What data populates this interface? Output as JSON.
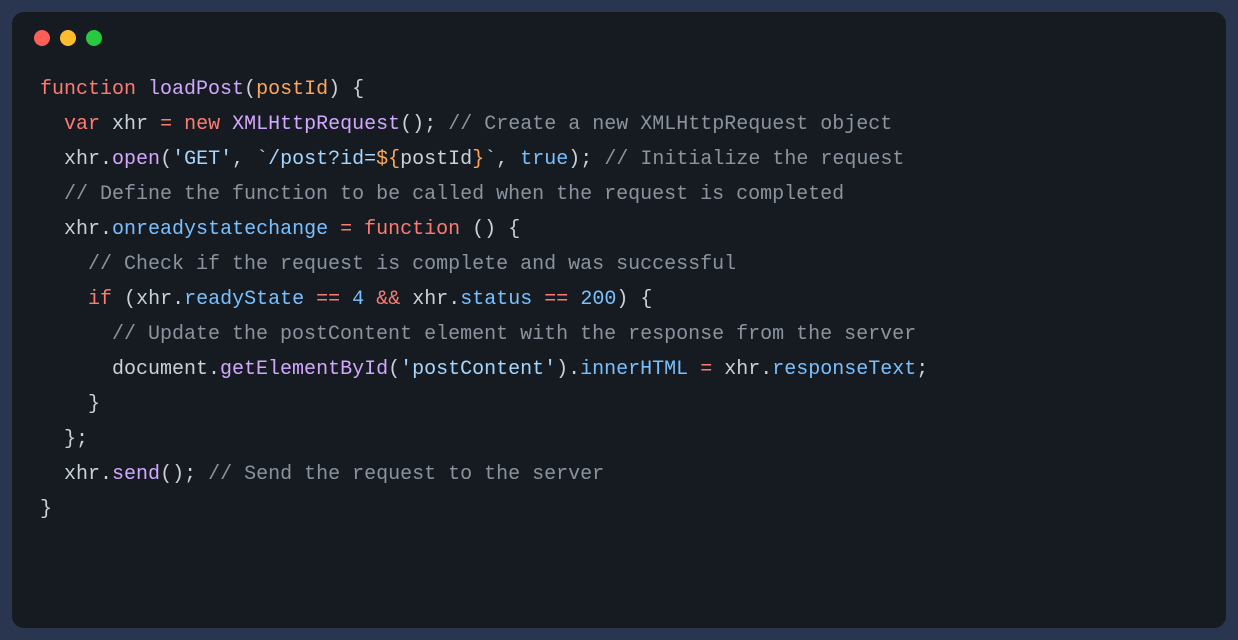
{
  "window": {
    "controls": [
      "close",
      "minimize",
      "maximize"
    ]
  },
  "code": {
    "language": "javascript",
    "tokens": [
      [
        {
          "t": "keyword",
          "v": "function"
        },
        {
          "t": "space",
          "v": " "
        },
        {
          "t": "func",
          "v": "loadPost"
        },
        {
          "t": "punct",
          "v": "("
        },
        {
          "t": "param",
          "v": "postId"
        },
        {
          "t": "punct",
          "v": ")"
        },
        {
          "t": "space",
          "v": " "
        },
        {
          "t": "punct",
          "v": "{"
        }
      ],
      [
        {
          "t": "indent",
          "v": "  "
        },
        {
          "t": "keyword",
          "v": "var"
        },
        {
          "t": "space",
          "v": " "
        },
        {
          "t": "ident",
          "v": "xhr"
        },
        {
          "t": "space",
          "v": " "
        },
        {
          "t": "op",
          "v": "="
        },
        {
          "t": "space",
          "v": " "
        },
        {
          "t": "keyword",
          "v": "new"
        },
        {
          "t": "space",
          "v": " "
        },
        {
          "t": "func",
          "v": "XMLHttpRequest"
        },
        {
          "t": "punct",
          "v": "()"
        },
        {
          "t": "punct",
          "v": ";"
        },
        {
          "t": "space",
          "v": " "
        },
        {
          "t": "comment",
          "v": "// Create a new XMLHttpRequest object"
        }
      ],
      [
        {
          "t": "indent",
          "v": "  "
        },
        {
          "t": "ident",
          "v": "xhr"
        },
        {
          "t": "punct",
          "v": "."
        },
        {
          "t": "func",
          "v": "open"
        },
        {
          "t": "punct",
          "v": "("
        },
        {
          "t": "string",
          "v": "'GET'"
        },
        {
          "t": "punct",
          "v": ","
        },
        {
          "t": "space",
          "v": " "
        },
        {
          "t": "string",
          "v": "`/post?id="
        },
        {
          "t": "interp",
          "v": "${"
        },
        {
          "t": "ident",
          "v": "postId"
        },
        {
          "t": "interp",
          "v": "}"
        },
        {
          "t": "string",
          "v": "`"
        },
        {
          "t": "punct",
          "v": ","
        },
        {
          "t": "space",
          "v": " "
        },
        {
          "t": "bool",
          "v": "true"
        },
        {
          "t": "punct",
          "v": ")"
        },
        {
          "t": "punct",
          "v": ";"
        },
        {
          "t": "space",
          "v": " "
        },
        {
          "t": "comment",
          "v": "// Initialize the request"
        }
      ],
      [
        {
          "t": "indent",
          "v": "  "
        },
        {
          "t": "comment",
          "v": "// Define the function to be called when the request is completed"
        }
      ],
      [
        {
          "t": "indent",
          "v": "  "
        },
        {
          "t": "ident",
          "v": "xhr"
        },
        {
          "t": "punct",
          "v": "."
        },
        {
          "t": "prop",
          "v": "onreadystatechange"
        },
        {
          "t": "space",
          "v": " "
        },
        {
          "t": "op",
          "v": "="
        },
        {
          "t": "space",
          "v": " "
        },
        {
          "t": "keyword",
          "v": "function"
        },
        {
          "t": "space",
          "v": " "
        },
        {
          "t": "punct",
          "v": "()"
        },
        {
          "t": "space",
          "v": " "
        },
        {
          "t": "punct",
          "v": "{"
        }
      ],
      [
        {
          "t": "indent",
          "v": "    "
        },
        {
          "t": "comment",
          "v": "// Check if the request is complete and was successful"
        }
      ],
      [
        {
          "t": "indent",
          "v": "    "
        },
        {
          "t": "keyword",
          "v": "if"
        },
        {
          "t": "space",
          "v": " "
        },
        {
          "t": "punct",
          "v": "("
        },
        {
          "t": "ident",
          "v": "xhr"
        },
        {
          "t": "punct",
          "v": "."
        },
        {
          "t": "prop",
          "v": "readyState"
        },
        {
          "t": "space",
          "v": " "
        },
        {
          "t": "op",
          "v": "=="
        },
        {
          "t": "space",
          "v": " "
        },
        {
          "t": "num",
          "v": "4"
        },
        {
          "t": "space",
          "v": " "
        },
        {
          "t": "op",
          "v": "&&"
        },
        {
          "t": "space",
          "v": " "
        },
        {
          "t": "ident",
          "v": "xhr"
        },
        {
          "t": "punct",
          "v": "."
        },
        {
          "t": "prop",
          "v": "status"
        },
        {
          "t": "space",
          "v": " "
        },
        {
          "t": "op",
          "v": "=="
        },
        {
          "t": "space",
          "v": " "
        },
        {
          "t": "num",
          "v": "200"
        },
        {
          "t": "punct",
          "v": ")"
        },
        {
          "t": "space",
          "v": " "
        },
        {
          "t": "punct",
          "v": "{"
        }
      ],
      [
        {
          "t": "indent",
          "v": "      "
        },
        {
          "t": "comment",
          "v": "// Update the postContent element with the response from the server"
        }
      ],
      [
        {
          "t": "indent",
          "v": "      "
        },
        {
          "t": "ident",
          "v": "document"
        },
        {
          "t": "punct",
          "v": "."
        },
        {
          "t": "func",
          "v": "getElementById"
        },
        {
          "t": "punct",
          "v": "("
        },
        {
          "t": "string",
          "v": "'postContent'"
        },
        {
          "t": "punct",
          "v": ")"
        },
        {
          "t": "punct",
          "v": "."
        },
        {
          "t": "prop",
          "v": "innerHTML"
        },
        {
          "t": "space",
          "v": " "
        },
        {
          "t": "op",
          "v": "="
        },
        {
          "t": "space",
          "v": " "
        },
        {
          "t": "ident",
          "v": "xhr"
        },
        {
          "t": "punct",
          "v": "."
        },
        {
          "t": "prop",
          "v": "responseText"
        },
        {
          "t": "punct",
          "v": ";"
        }
      ],
      [
        {
          "t": "indent",
          "v": "    "
        },
        {
          "t": "punct",
          "v": "}"
        }
      ],
      [
        {
          "t": "indent",
          "v": "  "
        },
        {
          "t": "punct",
          "v": "}"
        },
        {
          "t": "punct",
          "v": ";"
        }
      ],
      [
        {
          "t": "indent",
          "v": "  "
        },
        {
          "t": "ident",
          "v": "xhr"
        },
        {
          "t": "punct",
          "v": "."
        },
        {
          "t": "func",
          "v": "send"
        },
        {
          "t": "punct",
          "v": "()"
        },
        {
          "t": "punct",
          "v": ";"
        },
        {
          "t": "space",
          "v": " "
        },
        {
          "t": "comment",
          "v": "// Send the request to the server"
        }
      ],
      [
        {
          "t": "punct",
          "v": "}"
        }
      ]
    ]
  }
}
